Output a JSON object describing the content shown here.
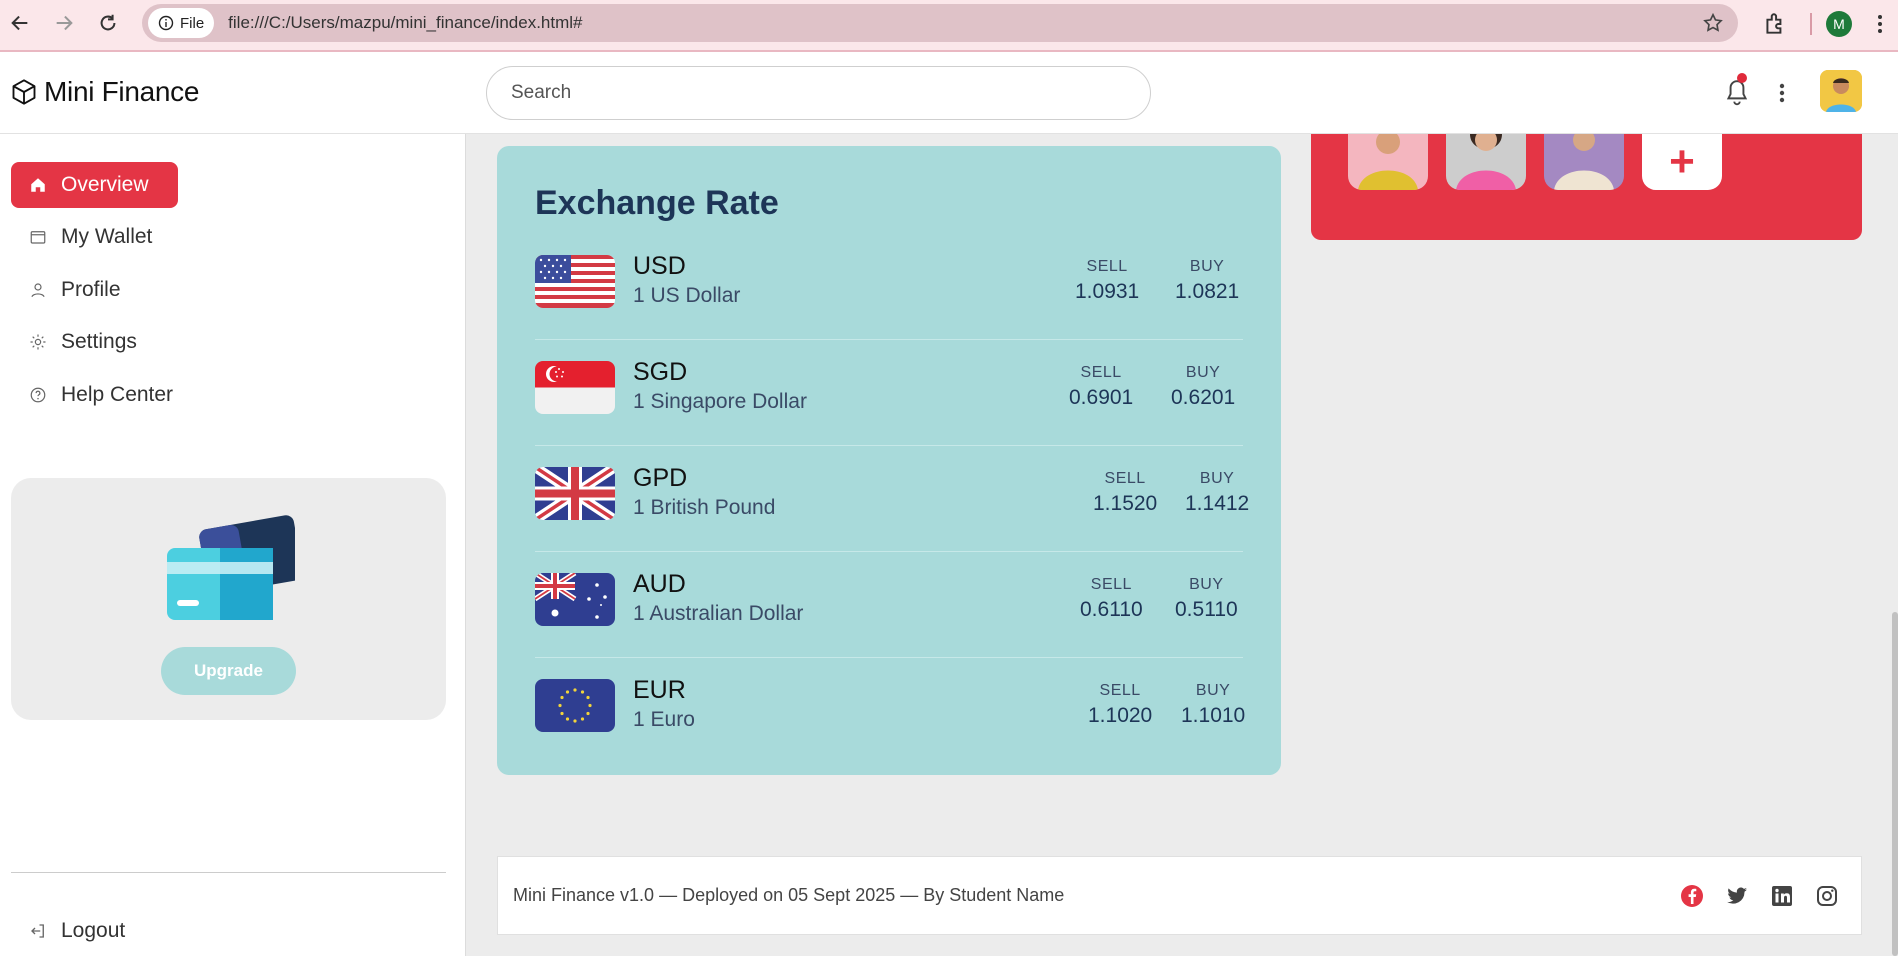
{
  "browser": {
    "file_chip": "File",
    "url": "file:///C:/Users/mazpu/mini_finance/index.html#",
    "profile_initial": "M"
  },
  "header": {
    "brand": "Mini Finance",
    "search_placeholder": "Search"
  },
  "sidebar": {
    "items": [
      {
        "label": "Overview",
        "active": true
      },
      {
        "label": "My Wallet",
        "active": false
      },
      {
        "label": "Profile",
        "active": false
      },
      {
        "label": "Settings",
        "active": false
      },
      {
        "label": "Help Center",
        "active": false
      }
    ],
    "upgrade_label": "Upgrade",
    "logout_label": "Logout"
  },
  "exchange": {
    "title": "Exchange Rate",
    "sell_label": "SELL",
    "buy_label": "BUY",
    "rates": [
      {
        "code": "USD",
        "name": "1 US Dollar",
        "sell": "1.0931",
        "buy": "1.0821"
      },
      {
        "code": "SGD",
        "name": "1 Singapore Dollar",
        "sell": "0.6901",
        "buy": "0.6201"
      },
      {
        "code": "GPD",
        "name": "1 British Pound",
        "sell": "1.1520",
        "buy": "1.1412"
      },
      {
        "code": "AUD",
        "name": "1 Australian Dollar",
        "sell": "0.6110",
        "buy": "0.5110"
      },
      {
        "code": "EUR",
        "name": "1 Euro",
        "sell": "1.1020",
        "buy": "1.1010"
      }
    ]
  },
  "team": {
    "add_label": "+"
  },
  "footer": {
    "text": "Mini Finance v1.0 — Deployed on 05 Sept 2025 — By Student Name"
  },
  "colors": {
    "accent": "#e43545",
    "card": "#a8dada",
    "navy": "#1d3557"
  }
}
